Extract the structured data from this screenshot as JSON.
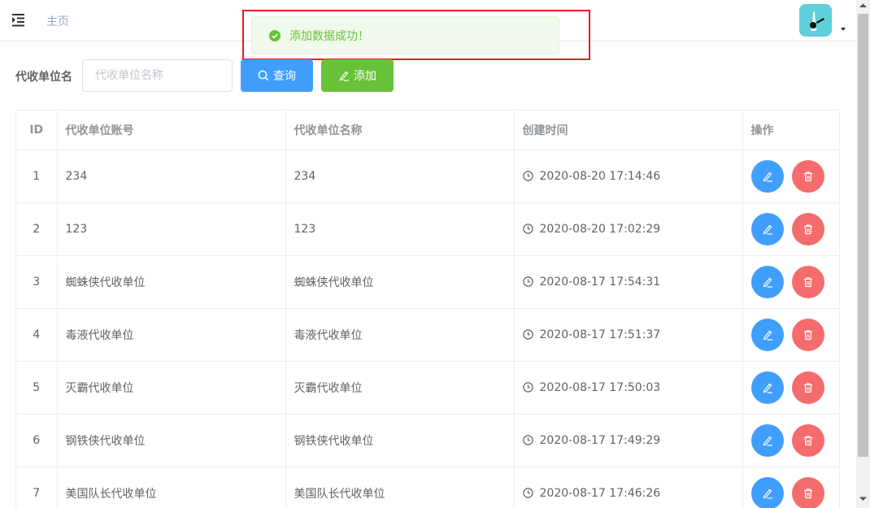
{
  "header": {
    "breadcrumb": "主页"
  },
  "toast": {
    "message": "添加数据成功！",
    "type": "success"
  },
  "filter": {
    "label": "代收单位名",
    "input_placeholder": "代收单位名称",
    "input_value": "",
    "query_label": "查询",
    "add_label": "添加"
  },
  "table": {
    "headers": [
      "ID",
      "代收单位账号",
      "代收单位名称",
      "创建时间",
      "操作"
    ],
    "rows": [
      {
        "id": "1",
        "account": "234",
        "name": "234",
        "created": "2020-08-20 17:14:46"
      },
      {
        "id": "2",
        "account": "123",
        "name": "123",
        "created": "2020-08-20 17:02:29"
      },
      {
        "id": "3",
        "account": "蜘蛛侠代收单位",
        "name": "蜘蛛侠代收单位",
        "created": "2020-08-17 17:54:31"
      },
      {
        "id": "4",
        "account": "毒液代收单位",
        "name": "毒液代收单位",
        "created": "2020-08-17 17:51:37"
      },
      {
        "id": "5",
        "account": "灭霸代收单位",
        "name": "灭霸代收单位",
        "created": "2020-08-17 17:50:03"
      },
      {
        "id": "6",
        "account": "钢铁侠代收单位",
        "name": "钢铁侠代收单位",
        "created": "2020-08-17 17:49:29"
      },
      {
        "id": "7",
        "account": "美国队长代收单位",
        "name": "美国队长代收单位",
        "created": "2020-08-17 17:46:26"
      }
    ]
  },
  "icons": {
    "menu": "indent-menu-icon",
    "success": "check-circle-icon",
    "search": "search-icon",
    "edit": "edit-pencil-icon",
    "delete": "trash-icon",
    "clock": "clock-icon",
    "caret": "caret-down-icon"
  },
  "colors": {
    "primary": "#409eff",
    "success": "#67c23a",
    "danger": "#f56c6c",
    "toast_bg": "#f0f9eb",
    "highlight": "#e02020"
  }
}
